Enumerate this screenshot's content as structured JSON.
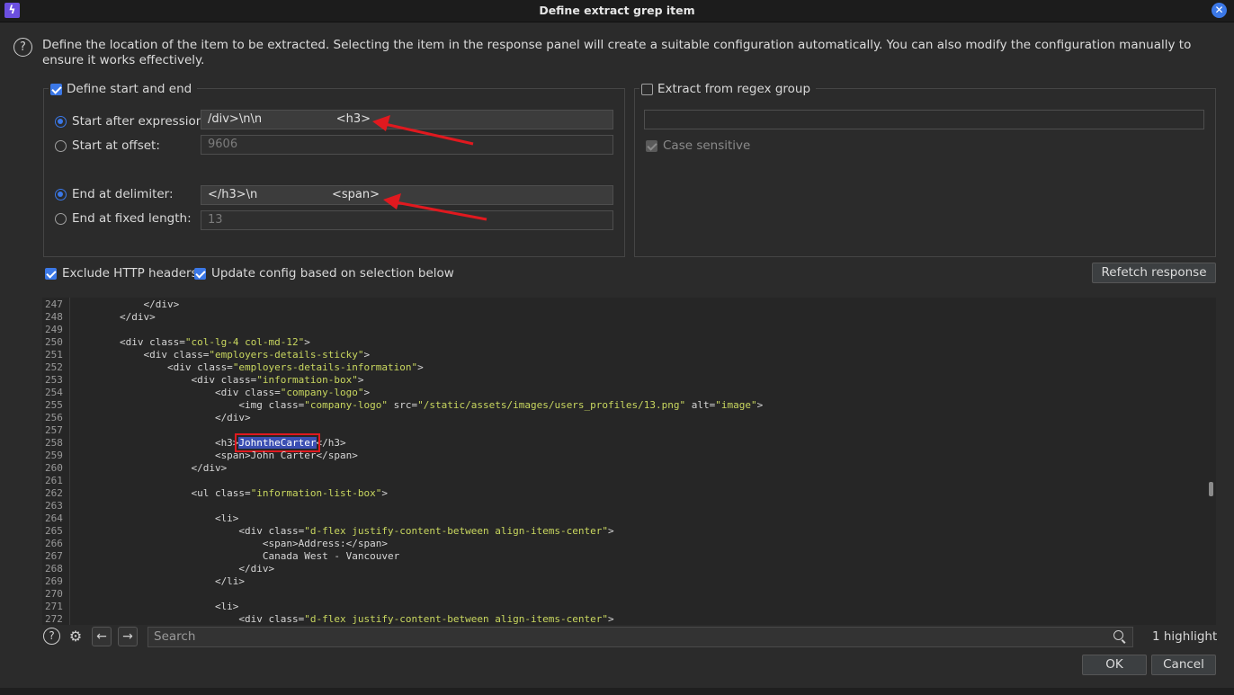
{
  "window": {
    "title": "Define extract grep item",
    "app_icon": "burp-lightning-icon"
  },
  "description": "Define the location of the item to be extracted. Selecting the item in the response panel will create a suitable configuration automatically. You can also modify the configuration manually to ensure it works effectively.",
  "start_end": {
    "label": "Define start and end",
    "checked": true,
    "start_after_label": "Start after expression:",
    "start_after_value": "/div>\\n\\n                    <h3>",
    "start_offset_label": "Start at offset:",
    "start_offset_value": "9606",
    "end_delim_label": "End at delimiter:",
    "end_delim_value": "</h3>\\n                    <span>",
    "end_fixed_label": "End at fixed length:",
    "end_fixed_value": "13"
  },
  "regex_group": {
    "label": "Extract from regex group",
    "checked": false,
    "value": "",
    "case_sensitive_label": "Case sensitive"
  },
  "options": {
    "exclude_headers_label": "Exclude HTTP headers",
    "update_config_label": "Update config based on selection below",
    "refetch_label": "Refetch response"
  },
  "code": {
    "highlight_text": "JohntheCarter",
    "lines": [
      {
        "n": "247",
        "t": "            </div>"
      },
      {
        "n": "248",
        "t": "        </div>"
      },
      {
        "n": "249",
        "t": ""
      },
      {
        "n": "250",
        "t": "        <div class=\"col-lg-4 col-md-12\">"
      },
      {
        "n": "251",
        "t": "            <div class=\"employers-details-sticky\">"
      },
      {
        "n": "252",
        "t": "                <div class=\"employers-details-information\">"
      },
      {
        "n": "253",
        "t": "                    <div class=\"information-box\">"
      },
      {
        "n": "254",
        "t": "                        <div class=\"company-logo\">"
      },
      {
        "n": "255",
        "t": "                            <img class=\"company-logo\" src=\"/static/assets/images/users_profiles/13.png\" alt=\"image\">"
      },
      {
        "n": "256",
        "t": "                        </div>"
      },
      {
        "n": "257",
        "t": ""
      },
      {
        "n": "258",
        "t": "                        <h3>JohntheCarter</h3>"
      },
      {
        "n": "259",
        "t": "                        <span>John Carter</span>"
      },
      {
        "n": "260",
        "t": "                    </div>"
      },
      {
        "n": "261",
        "t": ""
      },
      {
        "n": "262",
        "t": "                    <ul class=\"information-list-box\">"
      },
      {
        "n": "263",
        "t": ""
      },
      {
        "n": "264",
        "t": "                        <li>"
      },
      {
        "n": "265",
        "t": "                            <div class=\"d-flex justify-content-between align-items-center\">"
      },
      {
        "n": "266",
        "t": "                                <span>Address:</span>"
      },
      {
        "n": "267",
        "t": "                                Canada West - Vancouver"
      },
      {
        "n": "268",
        "t": "                            </div>"
      },
      {
        "n": "269",
        "t": "                        </li>"
      },
      {
        "n": "270",
        "t": ""
      },
      {
        "n": "271",
        "t": "                        <li>"
      },
      {
        "n": "272",
        "t": "                            <div class=\"d-flex justify-content-between align-items-center\">"
      }
    ]
  },
  "search": {
    "placeholder": "Search",
    "highlight_count": "1 highlight"
  },
  "buttons": {
    "ok": "OK",
    "cancel": "Cancel"
  },
  "colors": {
    "accent": "#3b78e7",
    "annotation_arrow": "#e0191f"
  }
}
